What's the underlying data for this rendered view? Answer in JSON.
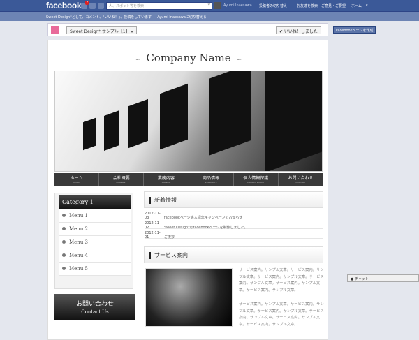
{
  "fb": {
    "logo": "facebook",
    "notif_count": "2",
    "search_placeholder": "人、スポット等を検索",
    "user_name": "Ayumi Inaesawa",
    "nav": [
      "投稿者の切り替え",
      "お友達を検索",
      "ご意見・ご要望",
      "ホーム",
      "▾"
    ],
    "subbar": "Sweet Design*として、コメント、「いいね！」、投稿をしています — Ayumi Inaesawaに切り替える",
    "page_selector": "Sweet Design*  サンプル【1】 ▾",
    "like_button": "✔ いいね！しました",
    "create_page": "Facebookページを作成",
    "chat": "● チャット"
  },
  "site": {
    "company": "Company Name",
    "ornament": "∽",
    "nav": [
      {
        "ja": "ホーム",
        "en": "HOME"
      },
      {
        "ja": "会社概要",
        "en": "COMPANY"
      },
      {
        "ja": "業務内容",
        "en": "SERVICE"
      },
      {
        "ja": "商品情報",
        "en": "PRODUCTS"
      },
      {
        "ja": "個人情報保護",
        "en": "PRIVACY POLICY"
      },
      {
        "ja": "お問い合わせ",
        "en": "CONTACT"
      }
    ],
    "category": "Category 1",
    "menus": [
      "Menu 1",
      "Menu 2",
      "Menu 3",
      "Menu 4",
      "Menu 5"
    ],
    "contact": {
      "ja": "お問い合わせ",
      "en": "Contact Us"
    },
    "news_title": "新着情報",
    "news": [
      {
        "date": "2012-11-03",
        "text": "facebookページ導入記念キャンペーンのお知らせ"
      },
      {
        "date": "2012-11-02",
        "text": "Sweet Design*のfacebookページを制作しました。"
      },
      {
        "date": "2012-11-01",
        "text": "ご挨拶"
      }
    ],
    "service_title": "サービス案内",
    "service_text": [
      "サービス案内。サンプル文章。サービス案内。サンプル文章。サービス案内。サンプル文章。サービス案内。サンプル文章。サービス案内。サンプル文章。サービス案内。サンプル文章。",
      "サービス案内。サンプル文章。サービス案内。サンプル文章。サービス案内。サンプル文章。サービス案内。サンプル文章。サービス案内。サンプル文章。サービス案内。サンプル文章。"
    ]
  }
}
